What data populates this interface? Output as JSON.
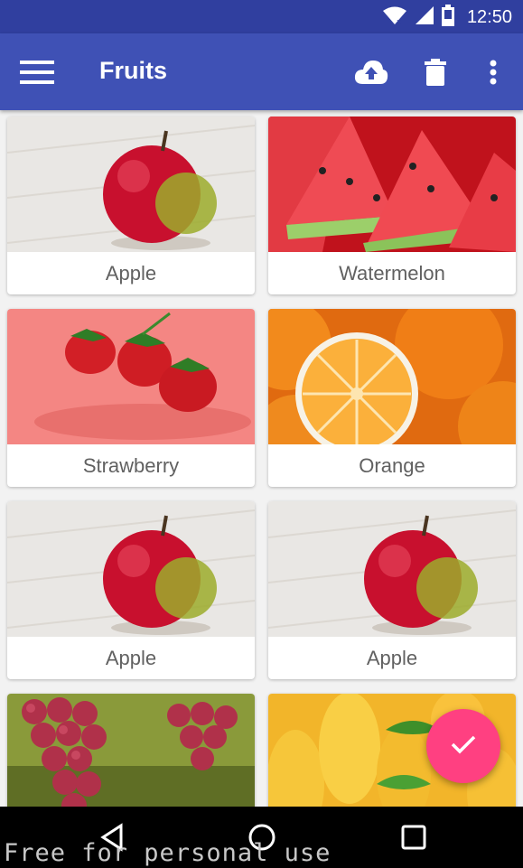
{
  "status_bar": {
    "time": "12:50",
    "icons": [
      "wifi-icon",
      "signal-icon",
      "battery-icon"
    ]
  },
  "app_bar": {
    "title": "Fruits",
    "color": "#3f51b5",
    "actions": [
      "upload-icon",
      "delete-icon",
      "overflow-menu-icon"
    ]
  },
  "cards": [
    {
      "label": "Apple"
    },
    {
      "label": "Watermelon"
    },
    {
      "label": "Strawberry"
    },
    {
      "label": "Orange"
    },
    {
      "label": "Apple"
    },
    {
      "label": "Apple"
    },
    {
      "label": ""
    },
    {
      "label": ""
    }
  ],
  "fab": {
    "icon": "check-icon",
    "color": "#ff4081"
  },
  "nav_bar": {
    "buttons": [
      "back-icon",
      "home-icon",
      "recents-icon"
    ]
  },
  "watermark": "Free for personal use"
}
